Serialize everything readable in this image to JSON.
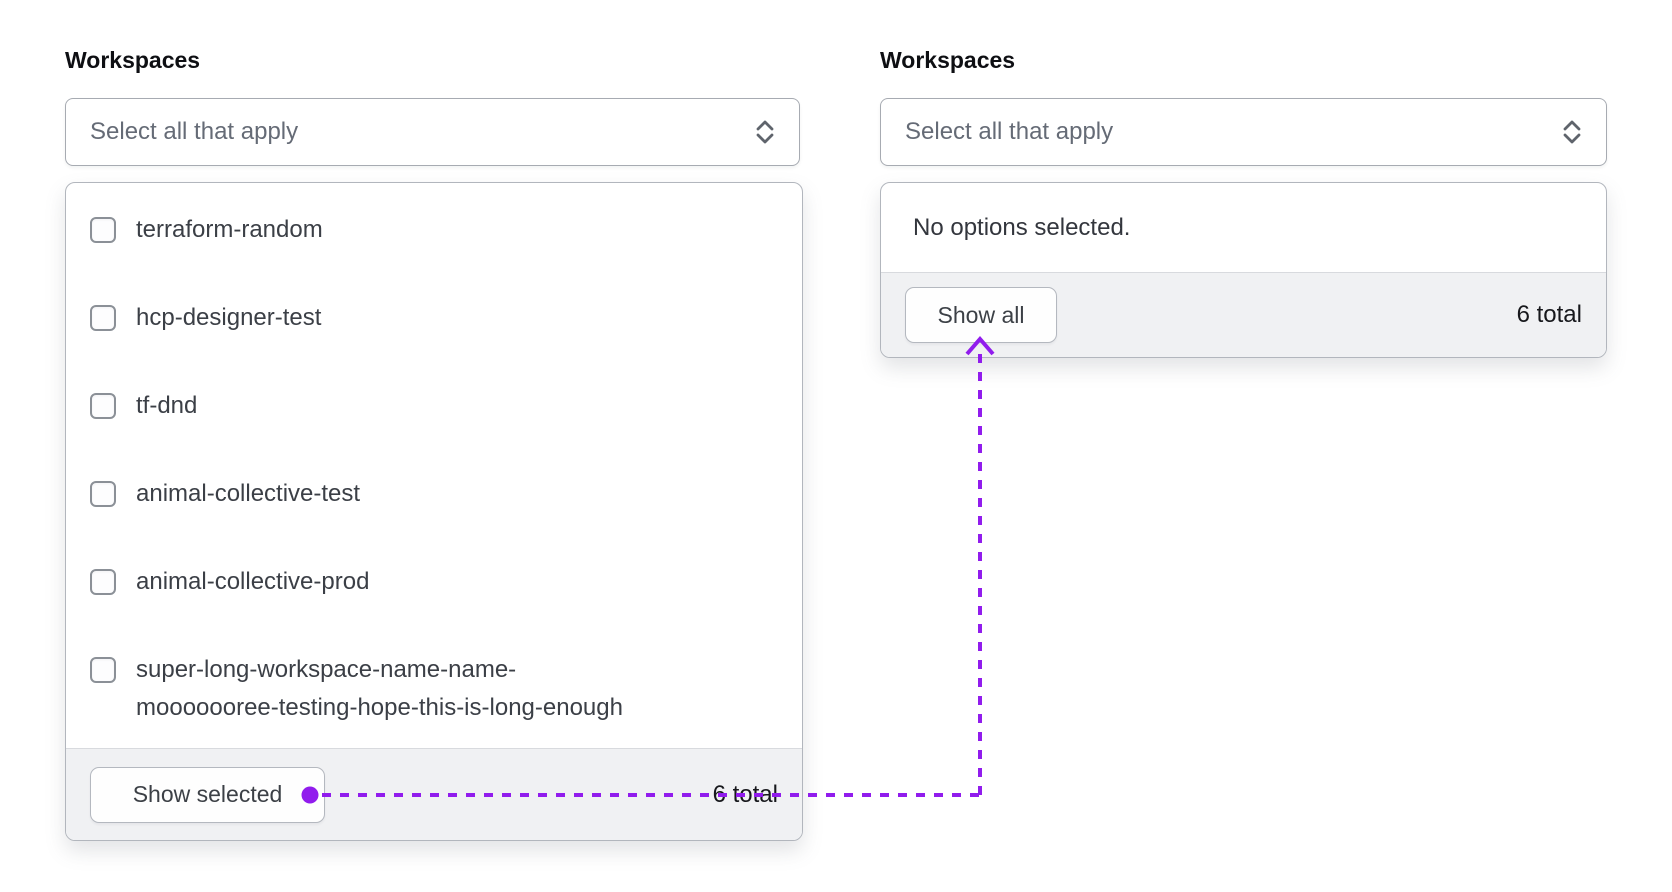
{
  "left_select": {
    "label": "Workspaces",
    "placeholder": "Select all that apply",
    "trigger_icon": "caret-sort-icon",
    "options": [
      {
        "label": "terraform-random",
        "checked": false
      },
      {
        "label": "hcp-designer-test",
        "checked": false
      },
      {
        "label": "tf-dnd",
        "checked": false
      },
      {
        "label": "animal-collective-test",
        "checked": false
      },
      {
        "label": "animal-collective-prod",
        "checked": false
      },
      {
        "label": "super-long-workspace-name-name-\nmooooooree-testing-hope-this-is-long-enough",
        "checked": false
      }
    ],
    "footer": {
      "button_label": "Show selected",
      "total": "6 total"
    }
  },
  "right_select": {
    "label": "Workspaces",
    "placeholder": "Select all that apply",
    "trigger_icon": "caret-sort-icon",
    "empty_message": "No options selected.",
    "footer": {
      "button_label": "Show all",
      "total": "6 total"
    }
  },
  "annotation": {
    "color": "#911ced"
  },
  "colors": {
    "accent_purple": "#911ced",
    "footer_background": "#f0f1f3",
    "border": "#b2b6bd"
  }
}
